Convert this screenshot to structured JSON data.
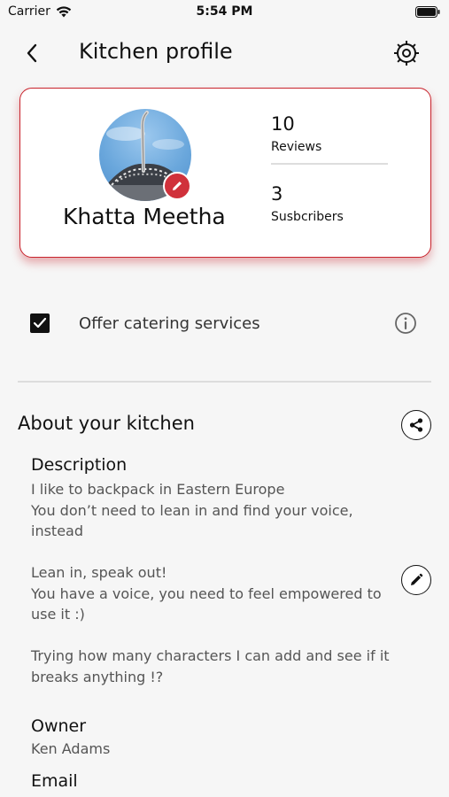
{
  "status_bar": {
    "carrier": "Carrier",
    "time": "5:54 PM"
  },
  "nav": {
    "title": "Kitchen profile",
    "back_icon": "chevron-left-icon",
    "settings_icon": "gear-icon"
  },
  "profile": {
    "kitchen_name": "Khatta Meetha",
    "reviews_count": "10",
    "reviews_label": "Reviews",
    "subscribers_count": "3",
    "subscribers_label": "Susbcribers",
    "accent_color": "#c8232c"
  },
  "catering": {
    "label": "Offer catering services",
    "checked": true
  },
  "about": {
    "title": "About your kitchen",
    "description_heading": "Description",
    "description_paragraphs": [
      "I like to backpack in Eastern Europe\nYou don’t need to lean in and find your voice, instead",
      "Lean in, speak out!\nYou have a voice, you need to feel empowered to use it :)",
      "Trying how many characters I can add and see if it breaks anything !?"
    ],
    "owner_heading": "Owner",
    "owner_value": "Ken Adams",
    "email_heading": "Email"
  }
}
